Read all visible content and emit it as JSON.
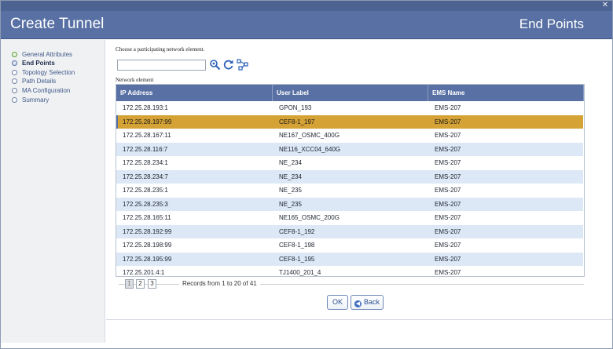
{
  "header": {
    "title": "Create Tunnel",
    "section": "End Points"
  },
  "sidebar": {
    "steps": [
      {
        "label": "General Attributes",
        "state": "done"
      },
      {
        "label": "End Points",
        "state": "active"
      },
      {
        "label": "Topology Selection",
        "state": "pending"
      },
      {
        "label": "Path Details",
        "state": "pending"
      },
      {
        "label": "MA Configuration",
        "state": "pending"
      },
      {
        "label": "Summary",
        "state": "pending"
      }
    ]
  },
  "main": {
    "instruction": "Choose a participating network element.",
    "search": {
      "value": "",
      "placeholder": ""
    },
    "tools": [
      "search-zoom-icon",
      "refresh-icon",
      "topology-icon"
    ],
    "table_label": "Network element",
    "columns": [
      "IP Address",
      "User Label",
      "EMS Name"
    ],
    "rows": [
      [
        "172.25.28.193:1",
        "GPON_193",
        "EMS-207"
      ],
      [
        "172.25.28.197:99",
        "CEF8-1_197",
        "EMS-207"
      ],
      [
        "172.25.28.167:11",
        "NE167_OSMC_400G",
        "EMS-207"
      ],
      [
        "172.25.28.116:7",
        "NE116_XCC04_640G",
        "EMS-207"
      ],
      [
        "172.25.28.234:1",
        "NE_234",
        "EMS-207"
      ],
      [
        "172.25.28.234:7",
        "NE_234",
        "EMS-207"
      ],
      [
        "172.25.28.235:1",
        "NE_235",
        "EMS-207"
      ],
      [
        "172.25.28.235:3",
        "NE_235",
        "EMS-207"
      ],
      [
        "172.25.28.165:11",
        "NE165_OSMC_200G",
        "EMS-207"
      ],
      [
        "172.25.28.192:99",
        "CEF8-1_192",
        "EMS-207"
      ],
      [
        "172.25.28.198:99",
        "CEF8-1_198",
        "EMS-207"
      ],
      [
        "172.25.28.195:99",
        "CEF8-1_195",
        "EMS-207"
      ],
      [
        "172.25.201.4:1",
        "TJ1400_201_4",
        "EMS-207"
      ]
    ],
    "selected_row": 1,
    "pagination": {
      "pages": [
        "1",
        "2",
        "3"
      ],
      "current": "1",
      "records": "Records from 1 to 20 of 41"
    },
    "buttons": {
      "ok": "OK",
      "back": "Back"
    }
  },
  "colors": {
    "header": "#5870a3",
    "selected": "#d4a235",
    "alt_row": "#dce8f5"
  }
}
